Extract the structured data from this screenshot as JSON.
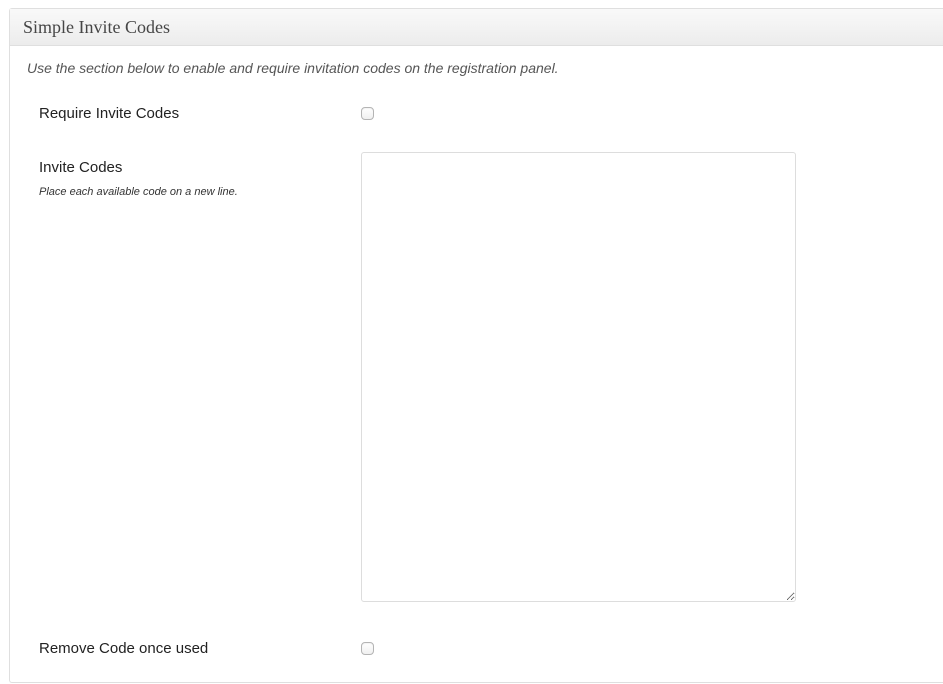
{
  "panel": {
    "title": "Simple Invite Codes",
    "description": "Use the section below to enable and require invitation codes on the registration panel."
  },
  "fields": {
    "require_invite": {
      "label": "Require Invite Codes",
      "checked": false
    },
    "invite_codes": {
      "label": "Invite Codes",
      "help": "Place each available code on a new line.",
      "value": ""
    },
    "remove_code": {
      "label": "Remove Code once used",
      "checked": false
    }
  }
}
